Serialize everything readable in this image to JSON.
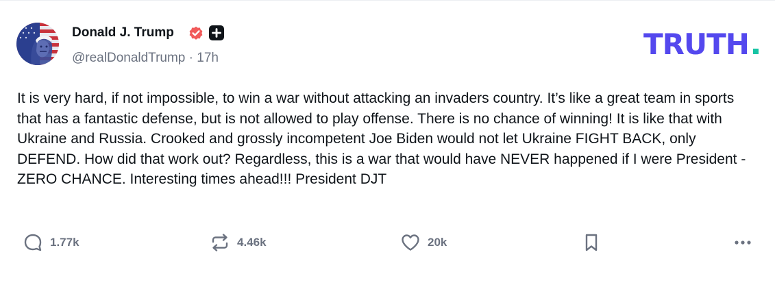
{
  "post": {
    "author": {
      "display_name": "Donald J. Trump",
      "handle_time": "@realDonaldTrump · 17h",
      "verified": true,
      "verified_color": "#f15a5a",
      "avatar_icon": "us-flag-portrait-avatar"
    },
    "brand": {
      "logo_text": "TRUTH",
      "logo_color": "#5448ee",
      "logo_dot_color": "#17c4a4"
    },
    "body": "It is very hard, if not impossible, to win a war without attacking an invaders country. It’s like a great team in sports that has a fantastic defense, but is not allowed to play offense. There is no chance of winning! It is like that with Ukraine and Russia. Crooked and grossly incompetent Joe Biden would not let Ukraine FIGHT BACK, only DEFEND. How did that work out? Regardless, this is a war that would have NEVER happened if I were President - ZERO CHANCE. Interesting times ahead!!! President DJT",
    "actions": {
      "replies": "1.77k",
      "retruths": "4.46k",
      "likes": "20k",
      "reply_icon": "comment-bubble-icon",
      "retruth_icon": "repost-arrows-icon",
      "like_icon": "heart-icon",
      "bookmark_icon": "bookmark-icon",
      "more_icon": "more-dots-icon"
    }
  }
}
